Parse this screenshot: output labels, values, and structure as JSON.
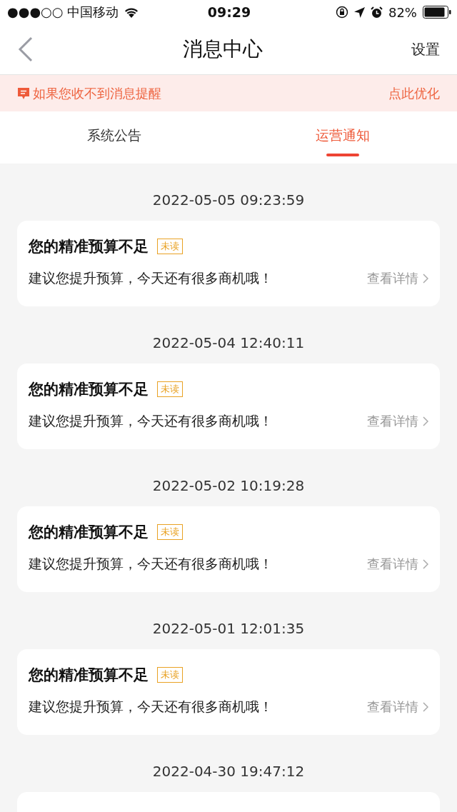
{
  "status_bar": {
    "carrier": "●●●○○ 中国移动",
    "time": "09:29",
    "battery": "82%"
  },
  "nav": {
    "title": "消息中心",
    "action": "设置"
  },
  "banner": {
    "text": "如果您收不到消息提醒",
    "action": "点此优化"
  },
  "tabs": [
    {
      "label": "系统公告",
      "selected": false
    },
    {
      "label": "运营通知",
      "selected": true
    }
  ],
  "messages": [
    {
      "time": "2022-05-05 09:23:59",
      "title": "您的精准预算不足",
      "badge": "未读",
      "body": "建议您提升预算，今天还有很多商机哦！",
      "link": "查看详情"
    },
    {
      "time": "2022-05-04 12:40:11",
      "title": "您的精准预算不足",
      "badge": "未读",
      "body": "建议您提升预算，今天还有很多商机哦！",
      "link": "查看详情"
    },
    {
      "time": "2022-05-02 10:19:28",
      "title": "您的精准预算不足",
      "badge": "未读",
      "body": "建议您提升预算，今天还有很多商机哦！",
      "link": "查看详情"
    },
    {
      "time": "2022-05-01 12:01:35",
      "title": "您的精准预算不足",
      "badge": "未读",
      "body": "建议您提升预算，今天还有很多商机哦！",
      "link": "查看详情"
    },
    {
      "time": "2022-04-30 19:47:12"
    }
  ]
}
